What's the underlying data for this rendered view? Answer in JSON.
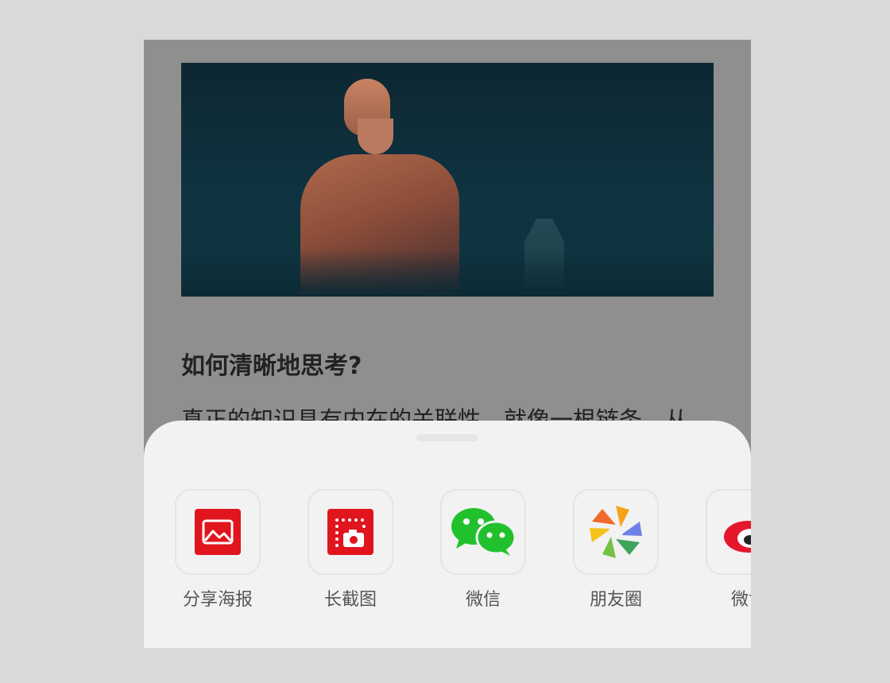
{
  "article": {
    "title": "如何清晰地思考?",
    "paragraph": "真正的知识具有内在的关联性，就像一根链条，从"
  },
  "share_sheet": {
    "items": [
      {
        "label": "分享海报",
        "icon": "poster-icon"
      },
      {
        "label": "长截图",
        "icon": "long-screenshot-icon"
      },
      {
        "label": "微信",
        "icon": "wechat-icon"
      },
      {
        "label": "朋友圈",
        "icon": "moments-icon"
      },
      {
        "label": "微博",
        "icon": "weibo-icon"
      }
    ]
  },
  "colors": {
    "brand_red": "#e0151d",
    "wechat_green": "#21c12d",
    "sheet_bg": "#f2f2f2",
    "overlay": "#8f8f8f"
  }
}
